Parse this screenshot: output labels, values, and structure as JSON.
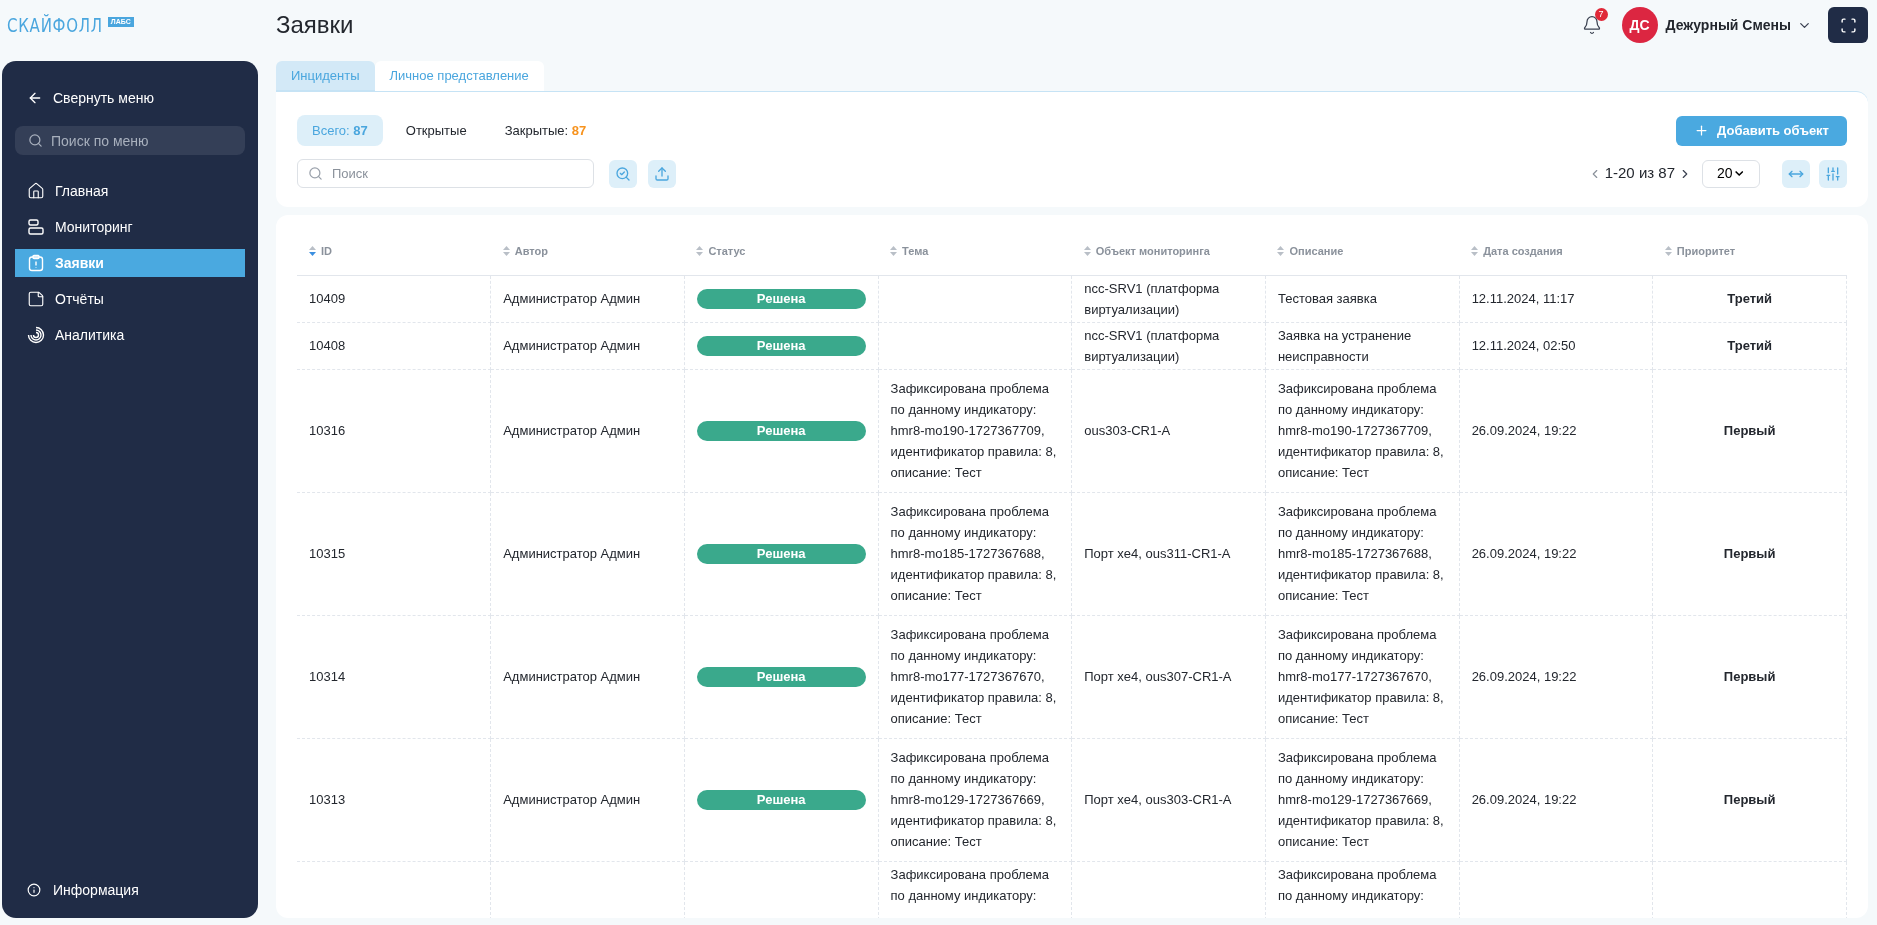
{
  "logo": {
    "name": "СКАЙФОЛЛ",
    "badge": "ЛАБС"
  },
  "page_title": "Заявки",
  "header": {
    "notifications": "7",
    "avatar": "ДС",
    "user": "Дежурный Смены"
  },
  "sidebar": {
    "collapse": "Свернуть меню",
    "search_placeholder": "Поиск по меню",
    "items": [
      {
        "kind": "home",
        "label": "Главная",
        "selected": false
      },
      {
        "kind": "monitoring",
        "label": "Мониторинг",
        "selected": false
      },
      {
        "kind": "tickets",
        "label": "Заявки",
        "selected": true
      },
      {
        "kind": "reports",
        "label": "Отчёты",
        "selected": false
      },
      {
        "kind": "analytics",
        "label": "Аналитика",
        "selected": false
      }
    ],
    "footer": "Информация"
  },
  "tabs": [
    {
      "label": "Инциденты",
      "selected": true
    },
    {
      "label": "Личное представление",
      "selected": false
    }
  ],
  "filters": [
    {
      "label": "Всего:",
      "count": "87",
      "color": "#4aa6de",
      "selected": true
    },
    {
      "label": "Открытые",
      "selected": false
    },
    {
      "label": "Закрытые:",
      "count": "87",
      "color": "#f7931e",
      "selected": false
    }
  ],
  "search": {
    "placeholder": "Поиск"
  },
  "add_button": "Добавить объект",
  "pagination": {
    "range": "1-20 из 87",
    "page_size": "20"
  },
  "table": {
    "columns": [
      {
        "label": "ID",
        "sorted": true
      },
      {
        "label": "Автор",
        "sorted": false
      },
      {
        "label": "Статус",
        "sorted": false
      },
      {
        "label": "Тема",
        "sorted": false
      },
      {
        "label": "Объект мониторинга",
        "sorted": false
      },
      {
        "label": "Описание",
        "sorted": false
      },
      {
        "label": "Дата создания",
        "sorted": false
      },
      {
        "label": "Приоритет",
        "sorted": false
      }
    ],
    "rows": [
      {
        "id": "10409",
        "author": "Администратор Админ",
        "status": "Решена",
        "object": "ncc-SRV1 (платформа виртуализации)",
        "description": "Тестовая заявка",
        "date": "12.11.2024, 11:17",
        "priority": "Третий"
      },
      {
        "id": "10408",
        "author": "Администратор Админ",
        "status": "Решена",
        "object": "ncc-SRV1 (платформа виртуализации)",
        "description": "Заявка на устранение неисправности",
        "date": "12.11.2024, 02:50",
        "priority": "Третий"
      },
      {
        "id": "10316",
        "author": "Администратор Админ",
        "status": "Решена",
        "topic": "Зафиксирована проблема по данному индикатору: hmr8-mo190-1727367709, идентификатор правила: 8, описание: Тест",
        "object": "ous303-CR1-A",
        "description": "Зафиксирована проблема по данному индикатору: hmr8-mo190-1727367709, идентификатор правила: 8, описание: Тест",
        "date": "26.09.2024, 19:22",
        "priority": "Первый"
      },
      {
        "id": "10315",
        "author": "Администратор Админ",
        "status": "Решена",
        "topic": "Зафиксирована проблема по данному индикатору: hmr8-mo185-1727367688, идентификатор правила: 8, описание: Тест",
        "object": "Порт xe4, ous311-CR1-A",
        "description": "Зафиксирована проблема по данному индикатору: hmr8-mo185-1727367688, идентификатор правила: 8, описание: Тест",
        "date": "26.09.2024, 19:22",
        "priority": "Первый"
      },
      {
        "id": "10314",
        "author": "Администратор Админ",
        "status": "Решена",
        "topic": "Зафиксирована проблема по данному индикатору: hmr8-mo177-1727367670, идентификатор правила: 8, описание: Тест",
        "object": "Порт xe4, ous307-CR1-A",
        "description": "Зафиксирована проблема по данному индикатору: hmr8-mo177-1727367670, идентификатор правила: 8, описание: Тест",
        "date": "26.09.2024, 19:22",
        "priority": "Первый"
      },
      {
        "id": "10313",
        "author": "Администратор Админ",
        "status": "Решена",
        "topic": "Зафиксирована проблема по данному индикатору: hmr8-mo129-1727367669, идентификатор правила: 8, описание: Тест",
        "object": "Порт xe4, ous303-CR1-A",
        "description": "Зафиксирована проблема по данному индикатору: hmr8-mo129-1727367669, идентификатор правила: 8, описание: Тест",
        "date": "26.09.2024, 19:22",
        "priority": "Первый"
      },
      {
        "topic": "Зафиксирована проблема по данному индикатору:",
        "description": "Зафиксирована проблема по данному индикатору:"
      }
    ]
  }
}
